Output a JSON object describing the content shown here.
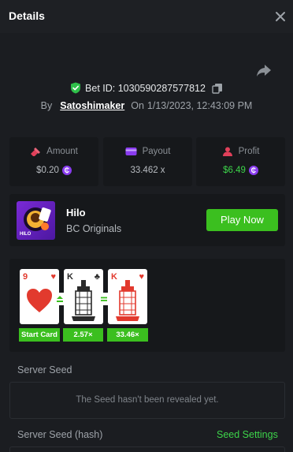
{
  "header": {
    "title": "Details"
  },
  "bet": {
    "id_label": "Bet ID: 1030590287577812",
    "by_label": "By",
    "user": "Satoshimaker",
    "on_label": "On",
    "datetime": "1/13/2023, 12:43:09 PM"
  },
  "stats": {
    "amount": {
      "label": "Amount",
      "value": "$0.20"
    },
    "payout": {
      "label": "Payout",
      "value": "33.462 x"
    },
    "profit": {
      "label": "Profit",
      "value": "$6.49"
    }
  },
  "game": {
    "name": "Hilo",
    "provider": "BC Originals",
    "thumb_text": "HILO",
    "play_label": "Play Now"
  },
  "cards": [
    {
      "rank": "9",
      "suit": "♥",
      "color": "red",
      "tag": "Start Card"
    },
    {
      "rank": "K",
      "suit": "♣",
      "color": "black",
      "tag": "2.57×"
    },
    {
      "rank": "K",
      "suit": "♥",
      "color": "red",
      "tag": "33.46×"
    }
  ],
  "seeds": {
    "server_seed_label": "Server Seed",
    "server_seed_value": "The Seed hasn't been revealed yet.",
    "server_seed_hash_label": "Server Seed (hash)",
    "seed_settings_label": "Seed Settings"
  },
  "colors": {
    "accent_green": "#3bbf1f",
    "coin_purple": "#8a3cf0",
    "background": "#1b1d21",
    "panel": "#16181b"
  },
  "icons": {
    "close": "close-icon",
    "share": "share-icon",
    "shield": "shield-check-icon",
    "copy": "copy-icon",
    "amount": "bet-icon",
    "payout": "wallet-icon",
    "profit": "profit-icon",
    "coin": "coin-icon"
  }
}
